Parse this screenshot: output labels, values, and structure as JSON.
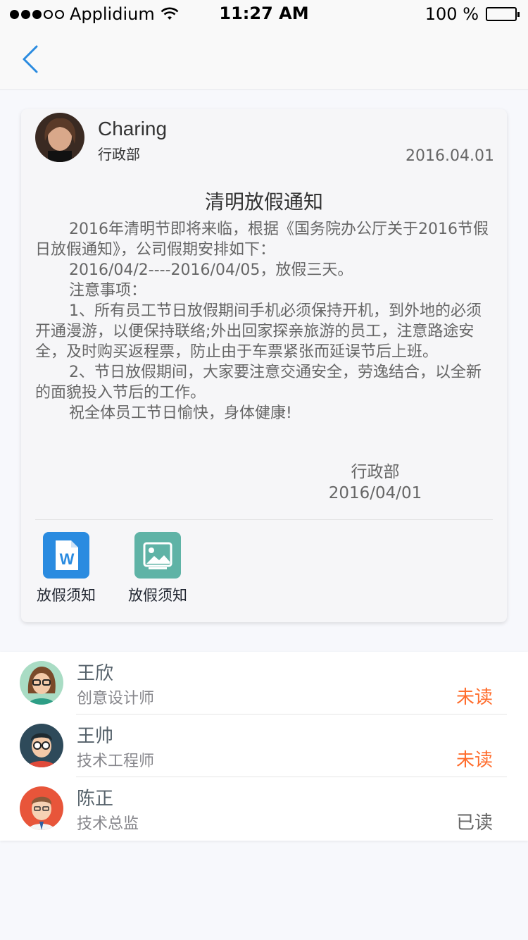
{
  "status_bar": {
    "carrier": "Applidium",
    "time": "11:27 AM",
    "battery": "100 %"
  },
  "notice": {
    "sender": "Charing",
    "department": "行政部",
    "date": "2016.04.01",
    "title": "清明放假通知",
    "paragraphs": [
      "2016年清明节即将来临，根据《国务院办公厅关于2016节假日放假通知》，公司假期安排如下：",
      "2016/04/2----2016/04/05，放假三天。",
      "注意事项：",
      "1、所有员工节日放假期间手机必须保持开机，到外地的必须开通漫游，以便保持联络;外出回家探亲旅游的员工，注意路途安全，及时购买返程票，防止由于车票紧张而延误节后上班。",
      "2、节日放假期间，大家要注意交通安全，劳逸结合，以全新的面貌投入节后的工作。",
      "祝全体员工节日愉快，身体健康!"
    ],
    "signature_dept": "行政部",
    "signature_date": "2016/04/01",
    "attachments": [
      {
        "label": "放假须知",
        "type": "word",
        "color": "#2a8be0"
      },
      {
        "label": "放假须知",
        "type": "image",
        "color": "#5fb3a6"
      }
    ]
  },
  "recipients": [
    {
      "name": "王欣",
      "role": "创意设计师",
      "status": "未读",
      "status_color": "#FF6D2D"
    },
    {
      "name": "王帅",
      "role": "技术工程师",
      "status": "未读",
      "status_color": "#FF6D2D"
    },
    {
      "name": "陈正",
      "role": "技术总监",
      "status": "已读",
      "status_color": "#666666"
    }
  ]
}
